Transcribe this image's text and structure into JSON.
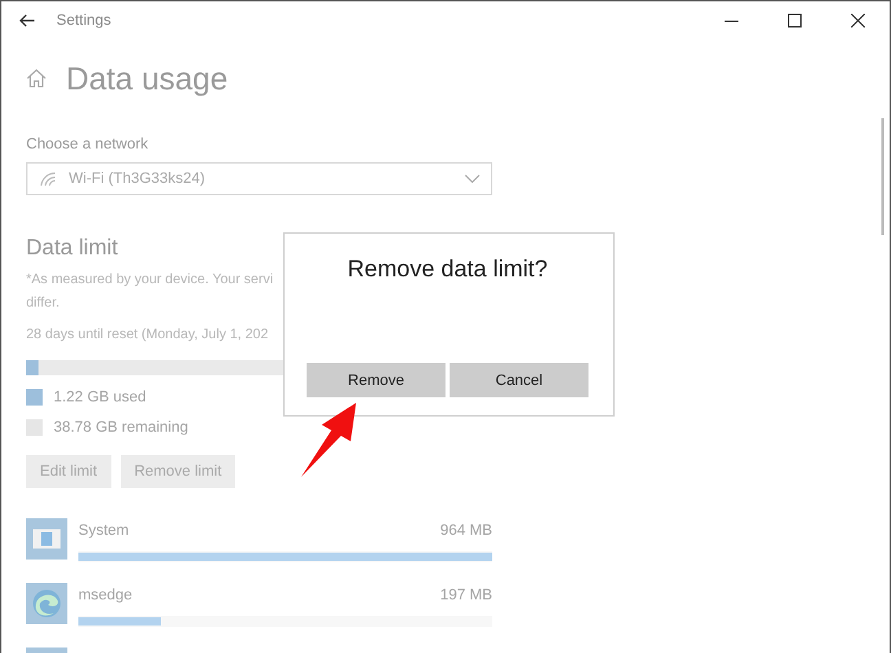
{
  "window": {
    "title": "Settings"
  },
  "page": {
    "title": "Data usage"
  },
  "network": {
    "label": "Choose a network",
    "value": "Wi-Fi (Th3G33ks24)"
  },
  "data_limit": {
    "heading": "Data limit",
    "note_lines": [
      "*As measured by your device. Your servi",
      "differ."
    ],
    "reset": "28 days until reset (Monday, July 1, 202",
    "usage": {
      "level": 0.05
    },
    "legend": [
      {
        "label": "1.22 GB used",
        "color": "#9dbfdc"
      },
      {
        "label": "38.78 GB remaining",
        "color": "#e6e6e6"
      }
    ],
    "buttons": [
      "Edit limit",
      "Remove limit"
    ]
  },
  "apps": [
    {
      "kind": "system",
      "name": "System",
      "usage": "964 MB",
      "level": 1.0
    },
    {
      "kind": "edge",
      "name": "msedge",
      "usage": "197 MB",
      "level": 0.2
    },
    {
      "kind": "generic"
    }
  ],
  "dialog": {
    "title": "Remove data limit?",
    "buttons": [
      "Remove",
      "Cancel"
    ]
  }
}
